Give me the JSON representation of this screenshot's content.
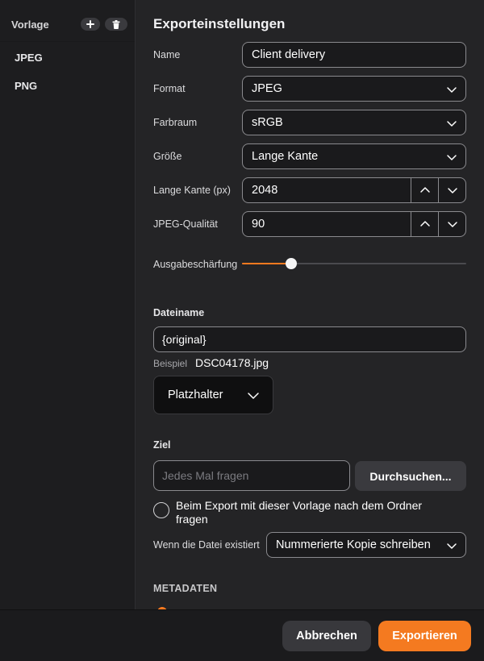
{
  "sidebar": {
    "title": "Vorlage",
    "add_icon": "plus-icon",
    "delete_icon": "trash-icon",
    "items": [
      {
        "label": "JPEG"
      },
      {
        "label": "PNG"
      }
    ]
  },
  "main": {
    "title": "Exporteinstellungen",
    "name": {
      "label": "Name",
      "value": "Client delivery"
    },
    "format": {
      "label": "Format",
      "value": "JPEG"
    },
    "colorspace": {
      "label": "Farbraum",
      "value": "sRGB"
    },
    "size": {
      "label": "Größe",
      "value": "Lange Kante"
    },
    "long_edge": {
      "label": "Lange Kante (px)",
      "value": "2048"
    },
    "quality": {
      "label": "JPEG-Qualität",
      "value": "90"
    },
    "sharpening": {
      "label": "Ausgabeschärfung",
      "level_fraction": 0.22
    }
  },
  "filename": {
    "heading": "Dateiname",
    "value": "{original}",
    "example_label": "Beispiel",
    "example_value": "DSC04178.jpg",
    "placeholder_button": "Platzhalter"
  },
  "destination": {
    "heading": "Ziel",
    "placeholder": "Jedes Mal fragen",
    "browse_button": "Durchsuchen...",
    "ask_folder_label": "Beim Export mit dieser Vorlage nach dem Ordner fragen",
    "exists_label": "Wenn die Datei existiert",
    "exists_value": "Nummerierte Kopie schreiben"
  },
  "metadata": {
    "heading": "METADATEN"
  },
  "footer": {
    "cancel": "Abbrechen",
    "export": "Exportieren"
  },
  "colors": {
    "accent": "#f47a20",
    "background": "#242426",
    "sidebar": "#1d1d1f"
  }
}
